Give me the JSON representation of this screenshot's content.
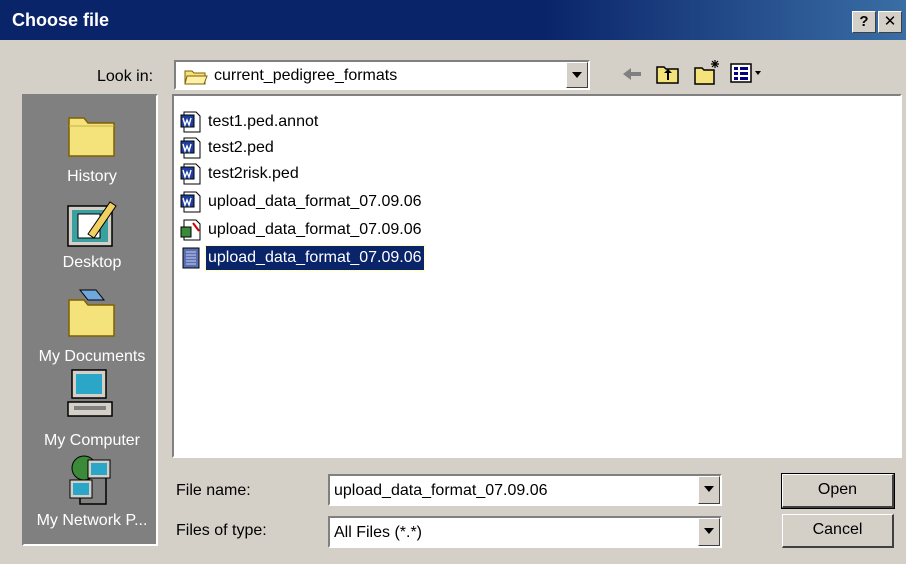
{
  "window": {
    "title": "Choose file",
    "help_label": "?",
    "close_label": "✕"
  },
  "toolbar": {
    "look_in_label": "Look in:",
    "look_in_value": "current_pedigree_formats"
  },
  "places": [
    {
      "label": "History",
      "icon": "history-folder-icon"
    },
    {
      "label": "Desktop",
      "icon": "desktop-icon"
    },
    {
      "label": "My Documents",
      "icon": "my-documents-folder-icon"
    },
    {
      "label": "My Computer",
      "icon": "my-computer-icon"
    },
    {
      "label": "My Network P...",
      "icon": "network-places-icon"
    }
  ],
  "files": [
    {
      "name": "test1.ped.annot",
      "icon": "word-document-icon",
      "selected": false
    },
    {
      "name": "test2.ped",
      "icon": "word-document-icon",
      "selected": false
    },
    {
      "name": "test2risk.ped",
      "icon": "word-document-icon",
      "selected": false
    },
    {
      "name": "upload_data_format_07.09.06",
      "icon": "word-document-icon",
      "selected": false
    },
    {
      "name": "upload_data_format_07.09.06",
      "icon": "spreadsheet-document-icon",
      "selected": false
    },
    {
      "name": "upload_data_format_07.09.06",
      "icon": "generic-document-icon",
      "selected": true
    }
  ],
  "form": {
    "file_name_label": "File name:",
    "file_name_value": "upload_data_format_07.09.06",
    "file_type_label": "Files of type:",
    "file_type_value": "All Files (*.*)"
  },
  "buttons": {
    "open_label": "Open",
    "cancel_label": "Cancel"
  },
  "colors": {
    "titlebar": "#0a246a",
    "selection": "#0a246a",
    "places_bg": "#808080",
    "dialog_bg": "#d4d0c8"
  }
}
